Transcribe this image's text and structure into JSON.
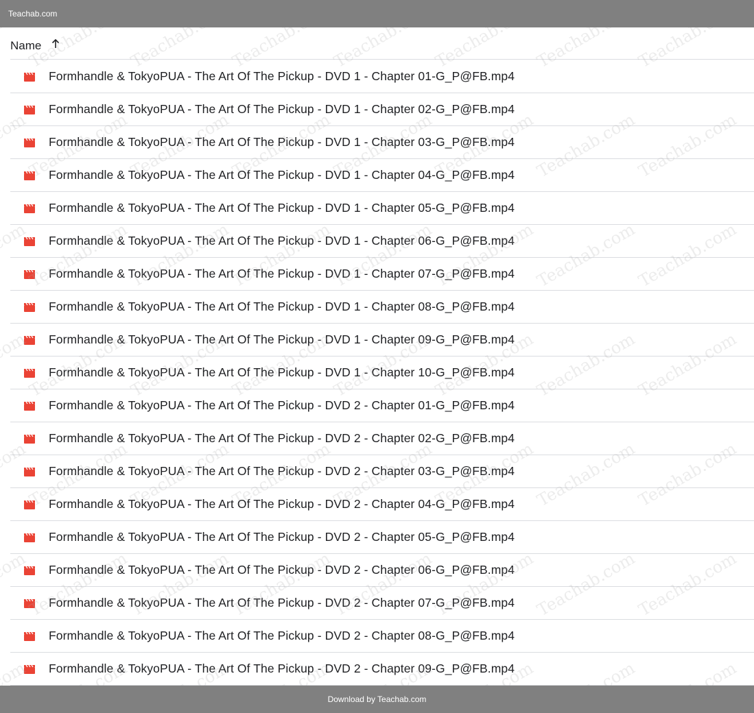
{
  "top_bar": {
    "title": "Teachab.com"
  },
  "header": {
    "column_name": "Name",
    "sort_icon": "arrow-up-icon"
  },
  "file_icon": {
    "name": "video-file-icon",
    "color": "#ea4335"
  },
  "files": [
    "Formhandle & TokyoPUA - The Art Of The Pickup - DVD 1 - Chapter 01-G_P@FB.mp4",
    "Formhandle & TokyoPUA - The Art Of The Pickup - DVD 1 - Chapter 02-G_P@FB.mp4",
    "Formhandle & TokyoPUA - The Art Of The Pickup - DVD 1 - Chapter 03-G_P@FB.mp4",
    "Formhandle & TokyoPUA - The Art Of The Pickup - DVD 1 - Chapter 04-G_P@FB.mp4",
    "Formhandle & TokyoPUA - The Art Of The Pickup - DVD 1 - Chapter 05-G_P@FB.mp4",
    "Formhandle & TokyoPUA - The Art Of The Pickup - DVD 1 - Chapter 06-G_P@FB.mp4",
    "Formhandle & TokyoPUA - The Art Of The Pickup - DVD 1 - Chapter 07-G_P@FB.mp4",
    "Formhandle & TokyoPUA - The Art Of The Pickup - DVD 1 - Chapter 08-G_P@FB.mp4",
    "Formhandle & TokyoPUA - The Art Of The Pickup - DVD 1 - Chapter 09-G_P@FB.mp4",
    "Formhandle & TokyoPUA - The Art Of The Pickup - DVD 1 - Chapter 10-G_P@FB.mp4",
    "Formhandle & TokyoPUA - The Art Of The Pickup - DVD 2 - Chapter 01-G_P@FB.mp4",
    "Formhandle & TokyoPUA - The Art Of The Pickup - DVD 2 - Chapter 02-G_P@FB.mp4",
    "Formhandle & TokyoPUA - The Art Of The Pickup - DVD 2 - Chapter 03-G_P@FB.mp4",
    "Formhandle & TokyoPUA - The Art Of The Pickup - DVD 2 - Chapter 04-G_P@FB.mp4",
    "Formhandle & TokyoPUA - The Art Of The Pickup - DVD 2 - Chapter 05-G_P@FB.mp4",
    "Formhandle & TokyoPUA - The Art Of The Pickup - DVD 2 - Chapter 06-G_P@FB.mp4",
    "Formhandle & TokyoPUA - The Art Of The Pickup - DVD 2 - Chapter 07-G_P@FB.mp4",
    "Formhandle & TokyoPUA - The Art Of The Pickup - DVD 2 - Chapter 08-G_P@FB.mp4",
    "Formhandle & TokyoPUA - The Art Of The Pickup - DVD 2 - Chapter 09-G_P@FB.mp4"
  ],
  "watermark": {
    "text": "Teachab.com"
  },
  "bottom_bar": {
    "text": "Download by Teachab.com"
  }
}
